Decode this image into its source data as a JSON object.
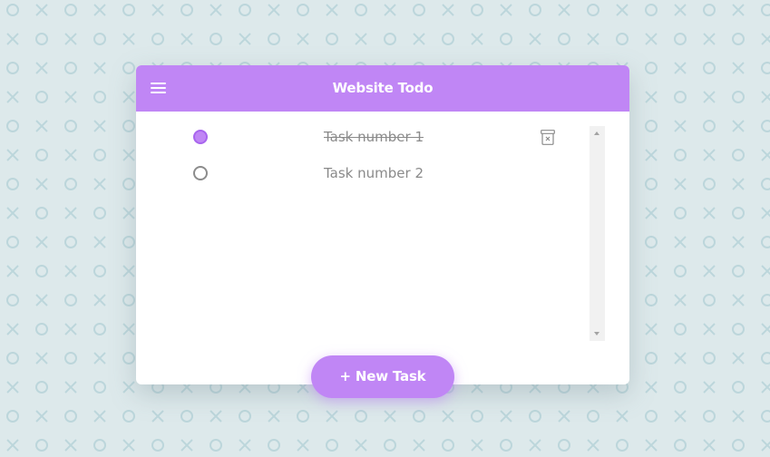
{
  "header": {
    "title": "Website Todo"
  },
  "tasks": [
    {
      "label": "Task number 1",
      "done": true
    },
    {
      "label": "Task number 2",
      "done": false
    }
  ],
  "new_task_button": {
    "label": "+ New Task"
  },
  "colors": {
    "accent": "#c086f5",
    "background": "#dde9eb",
    "pattern": "#bcd6db"
  }
}
